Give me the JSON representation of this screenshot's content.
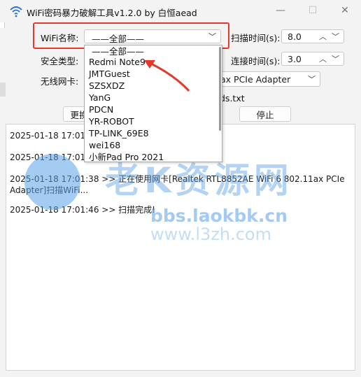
{
  "window": {
    "title": "WiFi密码暴力破解工具v1.2.0 by 白恒aead",
    "minimize": "—",
    "maximize": "☐",
    "close": "✕"
  },
  "form": {
    "wifi_name_label": "WiFi名称:",
    "wifi_name_value": "——全部——",
    "security_label": "安全类型:",
    "adapter_label": "无线网卡:",
    "adapter_value": "ax PCIe Adapter",
    "dict_value": "ds.txt",
    "scan_time_label": "扫描时间(s):",
    "scan_time_value": "8.0",
    "connect_time_label": "连接时间(s):",
    "connect_time_value": "3.0",
    "refresh_button": "更换",
    "stop_button": "停止"
  },
  "dropdown": {
    "items": [
      "——全部——",
      "Redmi Note9",
      "JMTGuest",
      "SZSXDZ",
      "YanG",
      "PDCN",
      "YR-ROBOT",
      "TP-LINK_69E8",
      "wei168",
      "小新Pad Pro 2021"
    ]
  },
  "log": {
    "lines": [
      "2025-01-18 17:01:",
      "2025-01-18 17:01:",
      "2025-01-18 17:01:38 >> 正在使用网卡[Realtek RTL8852AE WiFi 6 802.11ax PCIe",
      "Adapter]扫描WiFi...",
      "2025-01-18 17:01:46 >> 扫描完成!"
    ]
  },
  "watermark": {
    "site1": "bbs.laokbk.cn",
    "site2": "www.l3zh.com",
    "brand": "老K资源网"
  },
  "colors": {
    "highlight_box": "#e5372b",
    "arrow": "#e5372b",
    "watermark": "#5aa0e6"
  }
}
